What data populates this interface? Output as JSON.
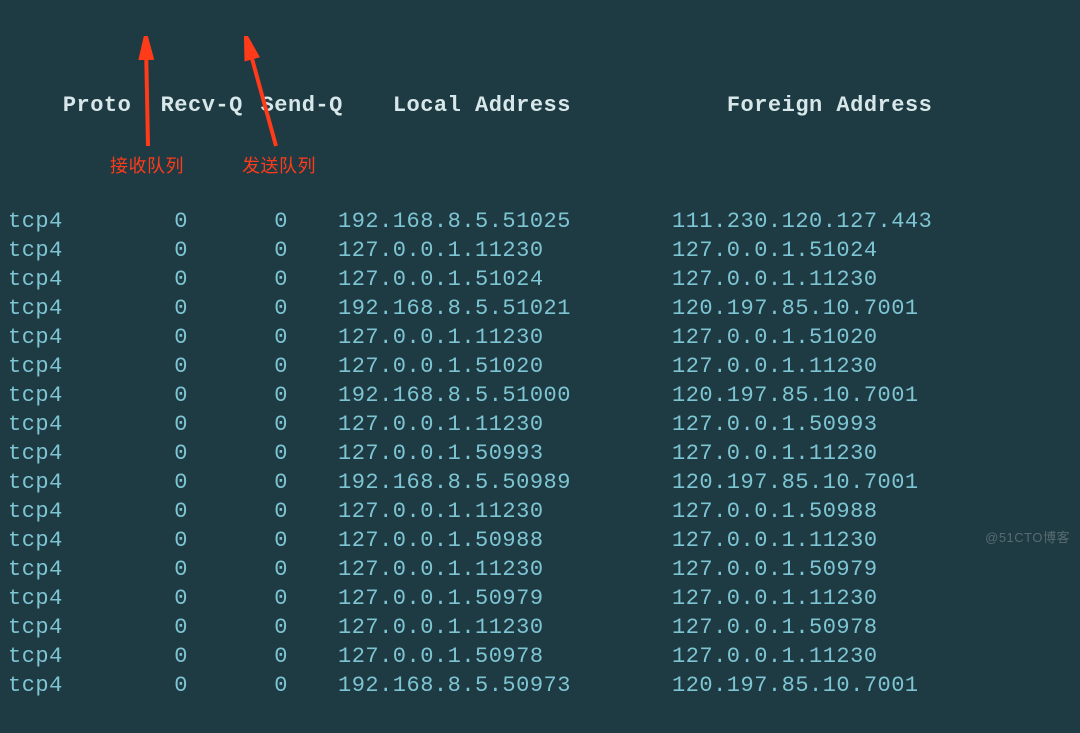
{
  "header": {
    "proto": "Proto",
    "recvq": "Recv-Q",
    "sendq": "Send-Q",
    "local": "Local Address",
    "foreign": "Foreign Address"
  },
  "rows": [
    {
      "proto": "tcp4",
      "recvq": "0",
      "sendq": "0",
      "local": "192.168.8.5.51025",
      "foreign": "111.230.120.127.443"
    },
    {
      "proto": "tcp4",
      "recvq": "0",
      "sendq": "0",
      "local": "127.0.0.1.11230",
      "foreign": "127.0.0.1.51024"
    },
    {
      "proto": "tcp4",
      "recvq": "0",
      "sendq": "0",
      "local": "127.0.0.1.51024",
      "foreign": "127.0.0.1.11230"
    },
    {
      "proto": "tcp4",
      "recvq": "0",
      "sendq": "0",
      "local": "192.168.8.5.51021",
      "foreign": "120.197.85.10.7001"
    },
    {
      "proto": "tcp4",
      "recvq": "0",
      "sendq": "0",
      "local": "127.0.0.1.11230",
      "foreign": "127.0.0.1.51020"
    },
    {
      "proto": "tcp4",
      "recvq": "0",
      "sendq": "0",
      "local": "127.0.0.1.51020",
      "foreign": "127.0.0.1.11230"
    },
    {
      "proto": "tcp4",
      "recvq": "0",
      "sendq": "0",
      "local": "192.168.8.5.51000",
      "foreign": "120.197.85.10.7001"
    },
    {
      "proto": "tcp4",
      "recvq": "0",
      "sendq": "0",
      "local": "127.0.0.1.11230",
      "foreign": "127.0.0.1.50993"
    },
    {
      "proto": "tcp4",
      "recvq": "0",
      "sendq": "0",
      "local": "127.0.0.1.50993",
      "foreign": "127.0.0.1.11230"
    },
    {
      "proto": "tcp4",
      "recvq": "0",
      "sendq": "0",
      "local": "192.168.8.5.50989",
      "foreign": "120.197.85.10.7001"
    },
    {
      "proto": "tcp4",
      "recvq": "0",
      "sendq": "0",
      "local": "127.0.0.1.11230",
      "foreign": "127.0.0.1.50988"
    },
    {
      "proto": "tcp4",
      "recvq": "0",
      "sendq": "0",
      "local": "127.0.0.1.50988",
      "foreign": "127.0.0.1.11230"
    },
    {
      "proto": "tcp4",
      "recvq": "0",
      "sendq": "0",
      "local": "127.0.0.1.11230",
      "foreign": "127.0.0.1.50979"
    },
    {
      "proto": "tcp4",
      "recvq": "0",
      "sendq": "0",
      "local": "127.0.0.1.50979",
      "foreign": "127.0.0.1.11230"
    },
    {
      "proto": "tcp4",
      "recvq": "0",
      "sendq": "0",
      "local": "127.0.0.1.11230",
      "foreign": "127.0.0.1.50978"
    },
    {
      "proto": "tcp4",
      "recvq": "0",
      "sendq": "0",
      "local": "127.0.0.1.50978",
      "foreign": "127.0.0.1.11230"
    },
    {
      "proto": "tcp4",
      "recvq": "0",
      "sendq": "0",
      "local": "192.168.8.5.50973",
      "foreign": "120.197.85.10.7001"
    }
  ],
  "annotations": {
    "recv_queue": "接收队列",
    "send_queue": "发送队列"
  },
  "watermark": "@51CTO博客"
}
